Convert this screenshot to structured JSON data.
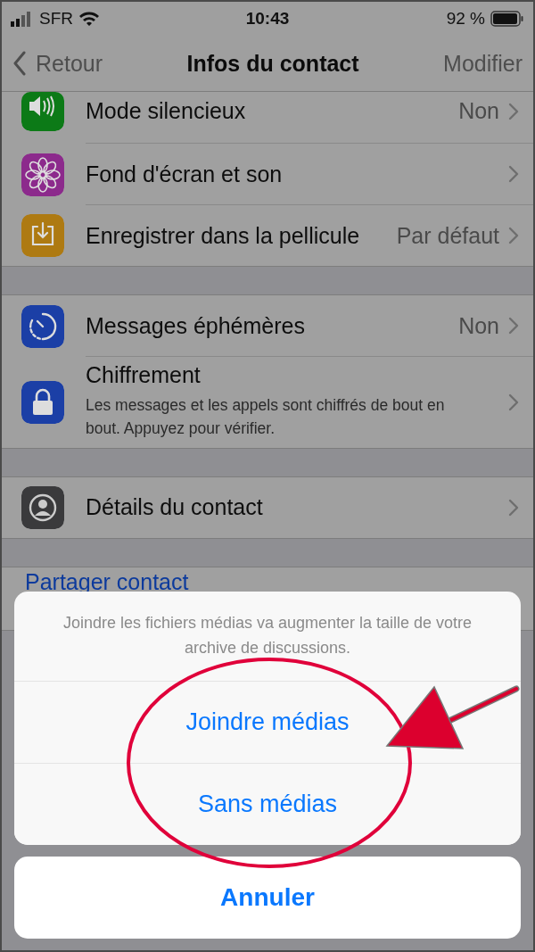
{
  "status_bar": {
    "carrier": "SFR",
    "time": "10:43",
    "battery": "92 %"
  },
  "nav": {
    "back": "Retour",
    "title": "Infos du contact",
    "action": "Modifier"
  },
  "sections": [
    {
      "rows": [
        {
          "kind": "plain",
          "color": "#0c7a17",
          "title": "Mode silencieux",
          "value": "Non"
        },
        {
          "kind": "plain",
          "color": "#8c2a8c",
          "title": "Fond d'écran et son"
        },
        {
          "kind": "plain",
          "color": "#ae7a12",
          "title": "Enregistrer dans la pellicule",
          "value": "Par défaut"
        }
      ]
    },
    {
      "rows": [
        {
          "kind": "plain",
          "color": "#1b3fa6",
          "title": "Messages éphémères",
          "value": "Non"
        },
        {
          "kind": "subtitle",
          "color": "#1b3fa6",
          "title": "Chiffrement",
          "subtitle": "Les messages et les appels sont chiffrés de bout en bout. Appuyez pour vérifier."
        }
      ]
    },
    {
      "rows": [
        {
          "kind": "plain",
          "color": "#3a3a3c",
          "title": "Détails du contact"
        }
      ]
    },
    {
      "rows": [
        {
          "kind": "link",
          "title": "Partager contact"
        }
      ]
    }
  ],
  "action_sheet": {
    "message": "Joindre les fichiers médias va augmenter la taille de votre archive de discussions.",
    "actions": [
      "Joindre médias",
      "Sans médias"
    ],
    "cancel": "Annuler"
  }
}
